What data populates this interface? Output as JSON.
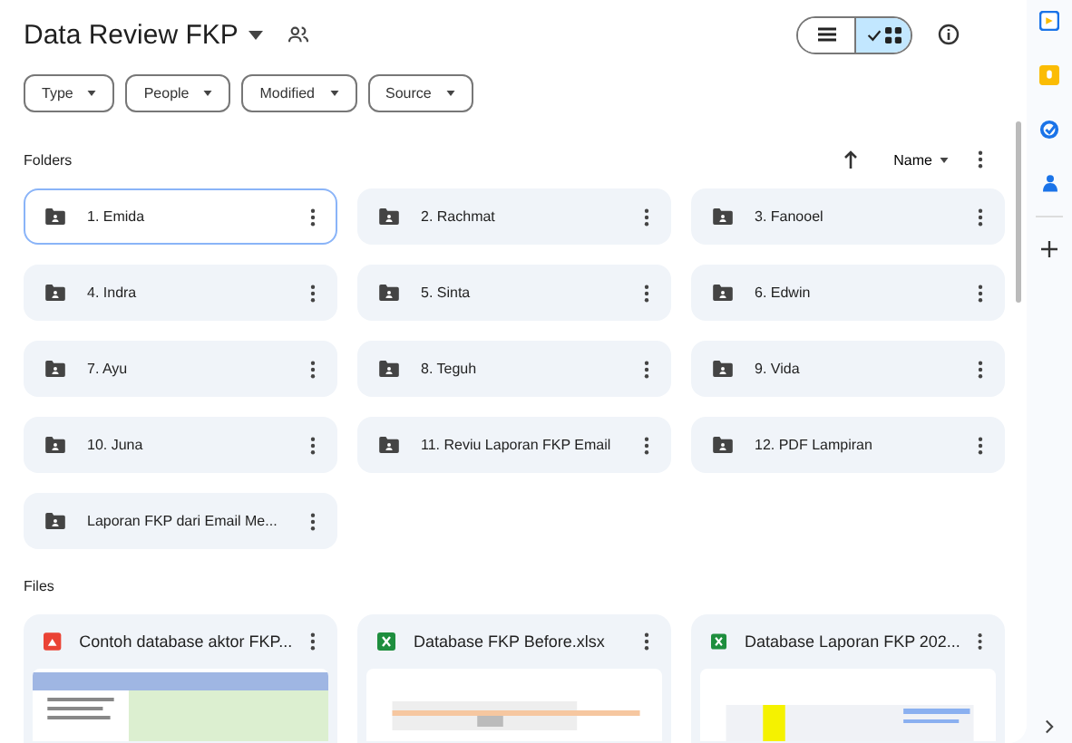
{
  "header": {
    "title": "Data Review FKP"
  },
  "view_toggle": [
    {
      "kind": "list",
      "selected": false
    },
    {
      "kind": "grid",
      "selected": true
    }
  ],
  "filters": [
    "Type",
    "People",
    "Modified",
    "Source"
  ],
  "folders_section": {
    "heading": "Folders",
    "sort": "Name"
  },
  "folders": [
    {
      "name": "1. Emida",
      "selected": true
    },
    {
      "name": "2. Rachmat",
      "selected": false
    },
    {
      "name": "3. Fanooel",
      "selected": false
    },
    {
      "name": "4. Indra",
      "selected": false
    },
    {
      "name": "5. Sinta",
      "selected": false
    },
    {
      "name": "6. Edwin",
      "selected": false
    },
    {
      "name": "7. Ayu",
      "selected": false
    },
    {
      "name": "8. Teguh",
      "selected": false
    },
    {
      "name": "9. Vida",
      "selected": false
    },
    {
      "name": "10. Juna",
      "selected": false
    },
    {
      "name": "11. Reviu Laporan FKP Email",
      "selected": false
    },
    {
      "name": "12. PDF Lampiran",
      "selected": false
    },
    {
      "name": "Laporan FKP dari Email Me...",
      "selected": false
    }
  ],
  "files_section": {
    "heading": "Files"
  },
  "files": [
    {
      "name": "Contoh database aktor FKP...",
      "kind": "pdf"
    },
    {
      "name": "Database FKP Before.xlsx",
      "kind": "xlsx"
    },
    {
      "name": "Database Laporan FKP 202...",
      "kind": "xlsx"
    }
  ]
}
